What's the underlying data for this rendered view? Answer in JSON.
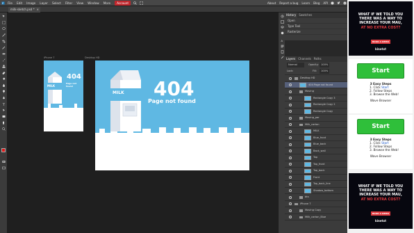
{
  "menu": {
    "items": [
      "File",
      "Edit",
      "Image",
      "Layer",
      "Select",
      "Filter",
      "View",
      "Window",
      "More"
    ],
    "account": "Account",
    "right_items": [
      "About",
      "Report a bug",
      "Learn",
      "Blog",
      "API"
    ]
  },
  "document": {
    "tab_name": "milk-sketch.psd *"
  },
  "artboards": {
    "small_label": "iPhone 7",
    "large_label": "Desktop HD",
    "title_404": "404",
    "subtitle": "Page not found",
    "small_title": "404",
    "small_subtitle": "Page not found",
    "milk_text": "MILK"
  },
  "history": {
    "tabs": [
      "History",
      "Swatches"
    ],
    "items": [
      "Open",
      "Type Tool",
      "Rasterize"
    ]
  },
  "layers": {
    "tabs": [
      "Layers",
      "Channels",
      "Paths"
    ],
    "blend_mode": "Normal",
    "opacity_label": "Opacity:",
    "opacity": "100%",
    "fill_label": "Fill:",
    "fill": "100%",
    "lock_label": "Lock:",
    "rows": [
      {
        "name": "Desktop HD",
        "type": "folder",
        "indent": 0
      },
      {
        "name": "404 Page not found",
        "type": "layer",
        "indent": 1,
        "selected": true
      },
      {
        "name": "Moving",
        "type": "folder",
        "indent": 1
      },
      {
        "name": "Rectangle Copy 3",
        "type": "layer",
        "indent": 2
      },
      {
        "name": "Rectangle Copy 2",
        "type": "layer",
        "indent": 2
      },
      {
        "name": "Rectangle Copy",
        "type": "layer",
        "indent": 2
      },
      {
        "name": "Moving_par",
        "type": "folder",
        "indent": 1
      },
      {
        "name": "Milk_carton",
        "type": "folder",
        "indent": 1
      },
      {
        "name": "MILK",
        "type": "layer",
        "indent": 2
      },
      {
        "name": "Blue_front",
        "type": "layer",
        "indent": 2
      },
      {
        "name": "Blue_back",
        "type": "layer",
        "indent": 2
      },
      {
        "name": "Back_wall",
        "type": "layer",
        "indent": 2
      },
      {
        "name": "Top",
        "type": "layer",
        "indent": 2
      },
      {
        "name": "Top_front",
        "type": "layer",
        "indent": 2
      },
      {
        "name": "Top_back",
        "type": "layer",
        "indent": 2
      },
      {
        "name": "Front",
        "type": "layer",
        "indent": 2
      },
      {
        "name": "Top_back_line",
        "type": "layer",
        "indent": 2
      },
      {
        "name": "Shadow_bottom",
        "type": "layer",
        "indent": 2
      },
      {
        "name": "bts",
        "type": "folder",
        "indent": 1
      },
      {
        "name": "iPhone 7",
        "type": "folder",
        "indent": 0
      },
      {
        "name": "Moving Copy",
        "type": "folder",
        "indent": 1
      },
      {
        "name": "Milk_carton_Blue",
        "type": "folder",
        "indent": 1
      }
    ]
  },
  "ads": {
    "headline1": "WHAT IF WE TOLD YOU THERE WAS A WAY TO INCREASE YOUR MAU,",
    "headline2": "AT NO EXTRA COST?",
    "demo_button": "BOOK A DEMO",
    "brand": "kinetxt",
    "start_label": "Start",
    "steps_title": "3 Easy Steps",
    "step1_prefix": "1. Click ",
    "step1_link": "Start",
    "step2": "2. Follow Steps",
    "step3": "3. Browse the Web!",
    "wave": "Wave Browser"
  },
  "colors": {
    "accent_red": "#c0262c",
    "artboard_blue": "#5fb8e3",
    "start_green": "#2fbf3a",
    "selected_layer": "#56607a",
    "ad_highlight": "#e23b40"
  }
}
